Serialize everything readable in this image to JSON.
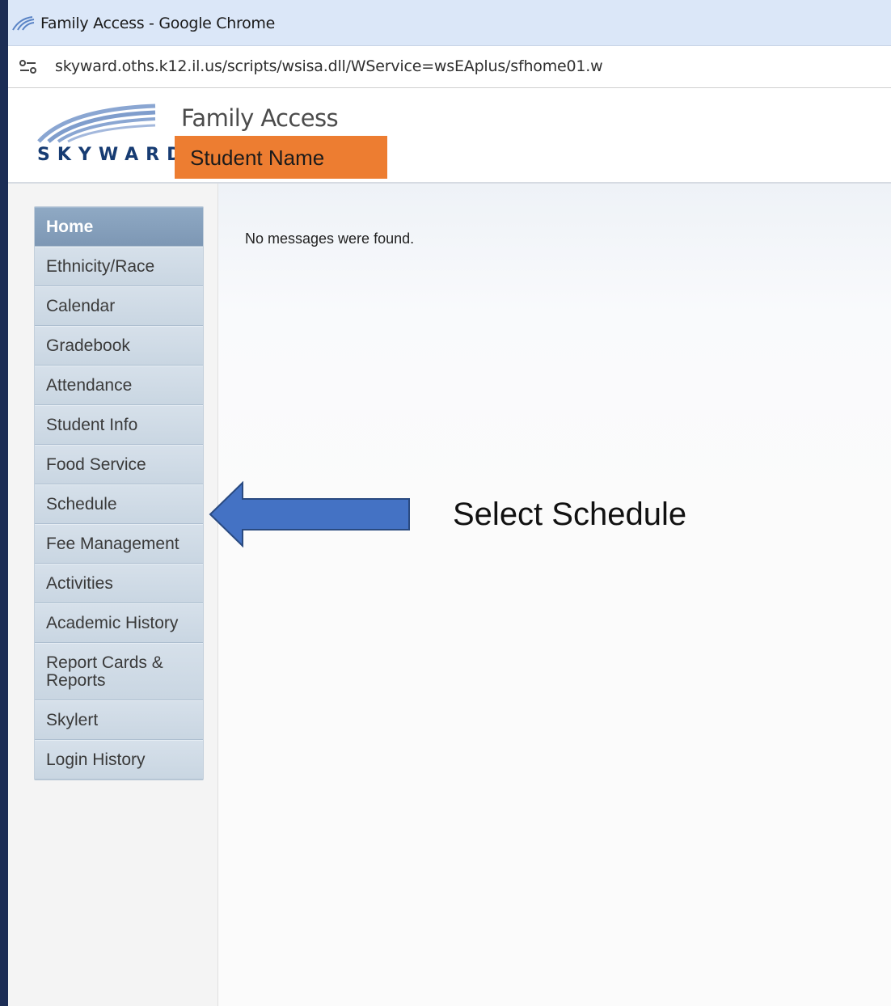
{
  "browser": {
    "window_title": "Family Access - Google Chrome",
    "url": "skyward.oths.k12.il.us/scripts/wsisa.dll/WService=wsEAplus/sfhome01.w",
    "favicon_icon": "skyward-favicon-icon",
    "site_info_icon": "tune-icon"
  },
  "header": {
    "logo_text": "SKYWARD",
    "app_title": "Family Access",
    "student_name": "Student Name",
    "student_box_color": "#ed7d31"
  },
  "sidebar": {
    "items": [
      {
        "label": "Home",
        "active": true
      },
      {
        "label": "Ethnicity/Race"
      },
      {
        "label": "Calendar"
      },
      {
        "label": "Gradebook"
      },
      {
        "label": "Attendance"
      },
      {
        "label": "Student Info"
      },
      {
        "label": "Food Service"
      },
      {
        "label": "Schedule"
      },
      {
        "label": "Fee Management"
      },
      {
        "label": "Activities"
      },
      {
        "label": "Academic History"
      },
      {
        "label": "Report Cards & Reports"
      },
      {
        "label": "Skylert"
      },
      {
        "label": "Login History"
      }
    ]
  },
  "main": {
    "message": "No messages were found."
  },
  "annotation": {
    "callout_text": "Select Schedule",
    "arrow_icon": "left-arrow-icon",
    "arrow_color": "#4472c4"
  }
}
